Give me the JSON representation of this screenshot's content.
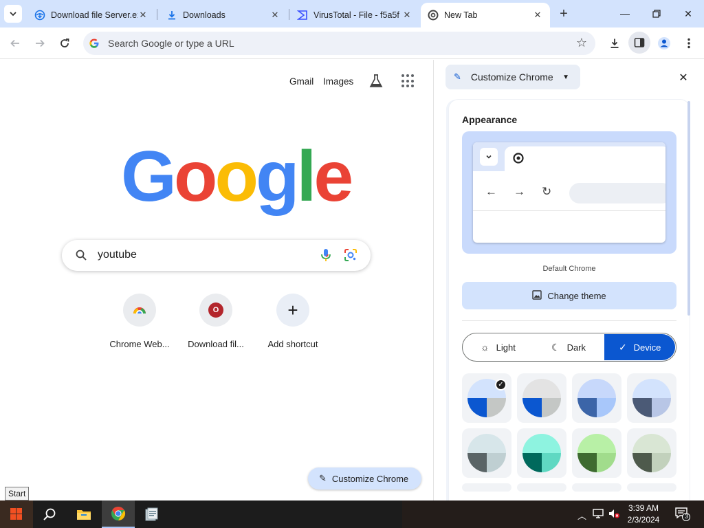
{
  "tabs": [
    {
      "title": "Download file Server.ex",
      "icon": "globe-download-icon"
    },
    {
      "title": "Downloads",
      "icon": "download-icon"
    },
    {
      "title": "VirusTotal - File - f5a5f",
      "icon": "virustotal-icon"
    },
    {
      "title": "New Tab",
      "icon": "chrome-icon",
      "active": true
    }
  ],
  "omnibox": {
    "placeholder": "Search Google or type a URL"
  },
  "ntp": {
    "links": [
      "Gmail",
      "Images"
    ],
    "logo": [
      "G",
      "o",
      "o",
      "g",
      "l",
      "e"
    ],
    "logo_colors": [
      "#4285f4",
      "#ea4335",
      "#fbbc05",
      "#4285f4",
      "#34a853",
      "#ea4335"
    ],
    "search_query": "youtube",
    "shortcuts": [
      {
        "label": "Chrome Web..."
      },
      {
        "label": "Download fil...",
        "glyph": "O"
      },
      {
        "label": "Add shortcut",
        "glyph": "+"
      }
    ],
    "customize_button": "Customize Chrome"
  },
  "side_panel": {
    "header": "Customize Chrome",
    "section_title": "Appearance",
    "theme_name": "Default Chrome",
    "change_theme": "Change theme",
    "modes": [
      "Light",
      "Dark",
      "Device"
    ],
    "selected_mode": "Device",
    "swatches": [
      {
        "top": "#d3e3fd",
        "left": "#0b57d0",
        "right": "#c4c7c5",
        "selected": true
      },
      {
        "top": "#e3e3e3",
        "left": "#0b57d0",
        "right": "#c4c7c5"
      },
      {
        "top": "#c7d8fb",
        "left": "#3c65a8",
        "right": "#a8c7fa"
      },
      {
        "top": "#d3e3fd",
        "left": "#4b5a76",
        "right": "#b8c6e6"
      },
      {
        "top": "#d7e6ea",
        "left": "#5a6466",
        "right": "#bfcfd2"
      },
      {
        "top": "#8ef3e0",
        "left": "#00695c",
        "right": "#5fd8c2"
      },
      {
        "top": "#b8f0a6",
        "left": "#3e6b30",
        "right": "#a1dc8c"
      },
      {
        "top": "#d9e6d4",
        "left": "#4e5a4c",
        "right": "#c2d1bc"
      }
    ]
  },
  "taskbar": {
    "tooltip": "Start",
    "time": "3:39 AM",
    "date": "2/3/2024",
    "notifications": "3"
  },
  "accent": "#0b57d0"
}
